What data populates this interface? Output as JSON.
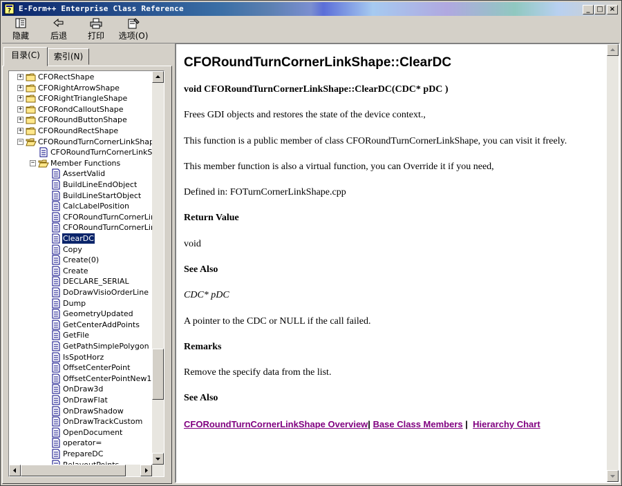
{
  "window": {
    "title": "E-Form++ Enterprise Class Reference",
    "controls": {
      "minimize": "_",
      "maximize": "□",
      "close": "×"
    }
  },
  "toolbar": {
    "hide_label": "隐藏",
    "back_label": "后退",
    "print_label": "打印",
    "options_label": "选项(O)"
  },
  "tabs": {
    "contents": "目录(C)",
    "index": "索引(N)"
  },
  "tree": {
    "items": [
      {
        "label": "CFORectShape",
        "kind": "book",
        "expander": "+"
      },
      {
        "label": "CFORightArrowShape",
        "kind": "book",
        "expander": "+"
      },
      {
        "label": "CFORightTriangleShape",
        "kind": "book",
        "expander": "+"
      },
      {
        "label": "CFORondCalloutShape",
        "kind": "book",
        "expander": "+"
      },
      {
        "label": "CFORoundButtonShape",
        "kind": "book",
        "expander": "+"
      },
      {
        "label": "CFORoundRectShape",
        "kind": "book",
        "expander": "+"
      },
      {
        "label": "CFORoundTurnCornerLinkShape",
        "kind": "open",
        "expander": "−"
      },
      {
        "label": "CFORoundTurnCornerLinkShape",
        "kind": "page",
        "expander": ""
      },
      {
        "label": "Member Functions",
        "kind": "open",
        "expander": "−"
      },
      {
        "label": "AssertValid",
        "kind": "page"
      },
      {
        "label": "BuildLineEndObject",
        "kind": "page"
      },
      {
        "label": "BuildLineStartObject",
        "kind": "page"
      },
      {
        "label": "CalcLabelPosition",
        "kind": "page"
      },
      {
        "label": "CFORoundTurnCornerLinkShape",
        "kind": "page"
      },
      {
        "label": "CFORoundTurnCornerLinkShape",
        "kind": "page"
      },
      {
        "label": "ClearDC",
        "kind": "page",
        "selected": true
      },
      {
        "label": "Copy",
        "kind": "page"
      },
      {
        "label": "Create(0)",
        "kind": "page"
      },
      {
        "label": "Create",
        "kind": "page"
      },
      {
        "label": "DECLARE_SERIAL",
        "kind": "page"
      },
      {
        "label": "DoDrawVisioOrderLine",
        "kind": "page"
      },
      {
        "label": "Dump",
        "kind": "page"
      },
      {
        "label": "GeometryUpdated",
        "kind": "page"
      },
      {
        "label": "GetCenterAddPoints",
        "kind": "page"
      },
      {
        "label": "GetFile",
        "kind": "page"
      },
      {
        "label": "GetPathSimplePolygon",
        "kind": "page"
      },
      {
        "label": "IsSpotHorz",
        "kind": "page"
      },
      {
        "label": "OffsetCenterPoint",
        "kind": "page"
      },
      {
        "label": "OffsetCenterPointNew1",
        "kind": "page"
      },
      {
        "label": "OnDraw3d",
        "kind": "page"
      },
      {
        "label": "OnDrawFlat",
        "kind": "page"
      },
      {
        "label": "OnDrawShadow",
        "kind": "page"
      },
      {
        "label": "OnDrawTrackCustom",
        "kind": "page"
      },
      {
        "label": "OpenDocument",
        "kind": "page"
      },
      {
        "label": "operator=",
        "kind": "page"
      },
      {
        "label": "PrepareDC",
        "kind": "page"
      },
      {
        "label": "RelayoutPoints",
        "kind": "page"
      }
    ]
  },
  "doc": {
    "heading": "CFORoundTurnCornerLinkShape::ClearDC",
    "signature": "void CFORoundTurnCornerLinkShape::ClearDC(CDC* pDC )",
    "desc1": "Frees GDI objects and restores the state of the device context.,",
    "desc2": "This function is a public member of class CFORoundTurnCornerLinkShape, you can visit it freely.",
    "desc3": "This member function is also a virtual function, you can Override it if you need,",
    "defined_in": "Defined in: FOTurnCornerLinkShape.cpp",
    "return_heading": "Return Value",
    "return_value": "void",
    "see_also_heading": "See Also",
    "param": "CDC* pDC",
    "param_desc": "A pointer to the CDC or NULL if the call failed.",
    "remarks_heading": "Remarks",
    "remarks": "Remove the specify data from the list.",
    "see_also_heading2": "See Also",
    "link_overview": "CFORoundTurnCornerLinkShape Overview",
    "link_base": "Base Class Members",
    "link_hierarchy": "Hierarchy Chart",
    "sep1": "|",
    "sep2": "|"
  },
  "colors": {
    "title_bar_start": "#0a246a",
    "selection": "#0a246a",
    "link": "#800080",
    "face": "#d4d0c8"
  }
}
